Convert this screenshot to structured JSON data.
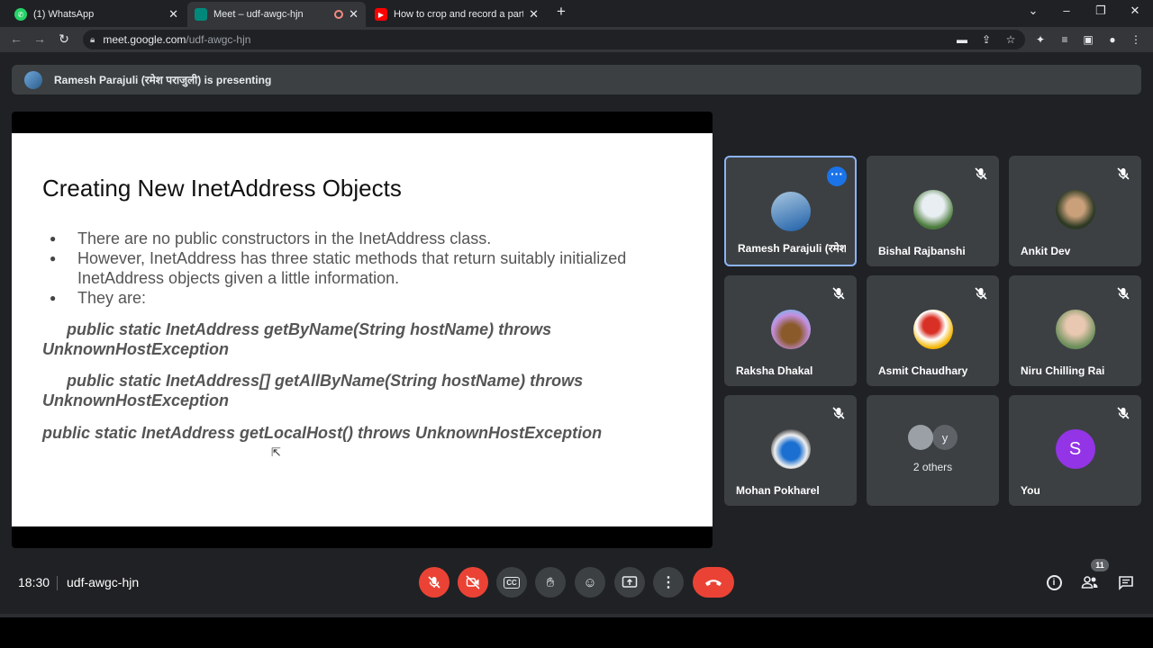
{
  "browser": {
    "tabs": [
      {
        "label": "(1) WhatsApp",
        "icon": "whatsapp-icon",
        "color": "#25d366"
      },
      {
        "label": "Meet – udf-awgc-hjn",
        "icon": "google-meet-icon",
        "color": "#00897b"
      },
      {
        "label": "How to crop and record a particu",
        "icon": "youtube-icon",
        "color": "#ff0000"
      }
    ],
    "url_host": "meet.google.com",
    "url_path": "/udf-awgc-hjn"
  },
  "meet": {
    "presenting_text": "Ramesh Parajuli (रमेश पराजुली) is presenting",
    "slide": {
      "title": "Creating New InetAddress Objects",
      "bullets": [
        "There are no public constructors in the InetAddress class.",
        "However, InetAddress has three static methods that return suitably initialized InetAddress objects given a little information.",
        "They are:"
      ],
      "signatures": [
        {
          "line1": "public static InetAddress getByName(String hostName) throws",
          "line2": "UnknownHostException"
        },
        {
          "line1": "public static InetAddress[] getAllByName(String hostName) throws",
          "line2": "UnknownHostException"
        },
        {
          "line1": "public static InetAddress getLocalHost() throws UnknownHostException",
          "line2": ""
        }
      ]
    },
    "participants": [
      {
        "name": "Ramesh Parajuli (रमेश पराजुली)",
        "muted": false,
        "active": true
      },
      {
        "name": "Bishal Rajbanshi",
        "muted": true
      },
      {
        "name": "Ankit Dev",
        "muted": true
      },
      {
        "name": "Raksha Dhakal",
        "muted": true
      },
      {
        "name": "Asmit Chaudhary",
        "muted": true
      },
      {
        "name": "Niru Chilling Rai",
        "muted": true
      },
      {
        "name": "Mohan Pokharel",
        "muted": true
      },
      {
        "name": "2 others",
        "avatar_letter": "y"
      },
      {
        "name": "You",
        "avatar_letter": "S",
        "muted": true
      }
    ],
    "time": "18:30",
    "meeting_code": "udf-awgc-hjn",
    "participant_count": "11",
    "colors": {
      "red": "#ea4335",
      "accent": "#8ab4f8",
      "you_avatar": "#9334e6"
    }
  }
}
